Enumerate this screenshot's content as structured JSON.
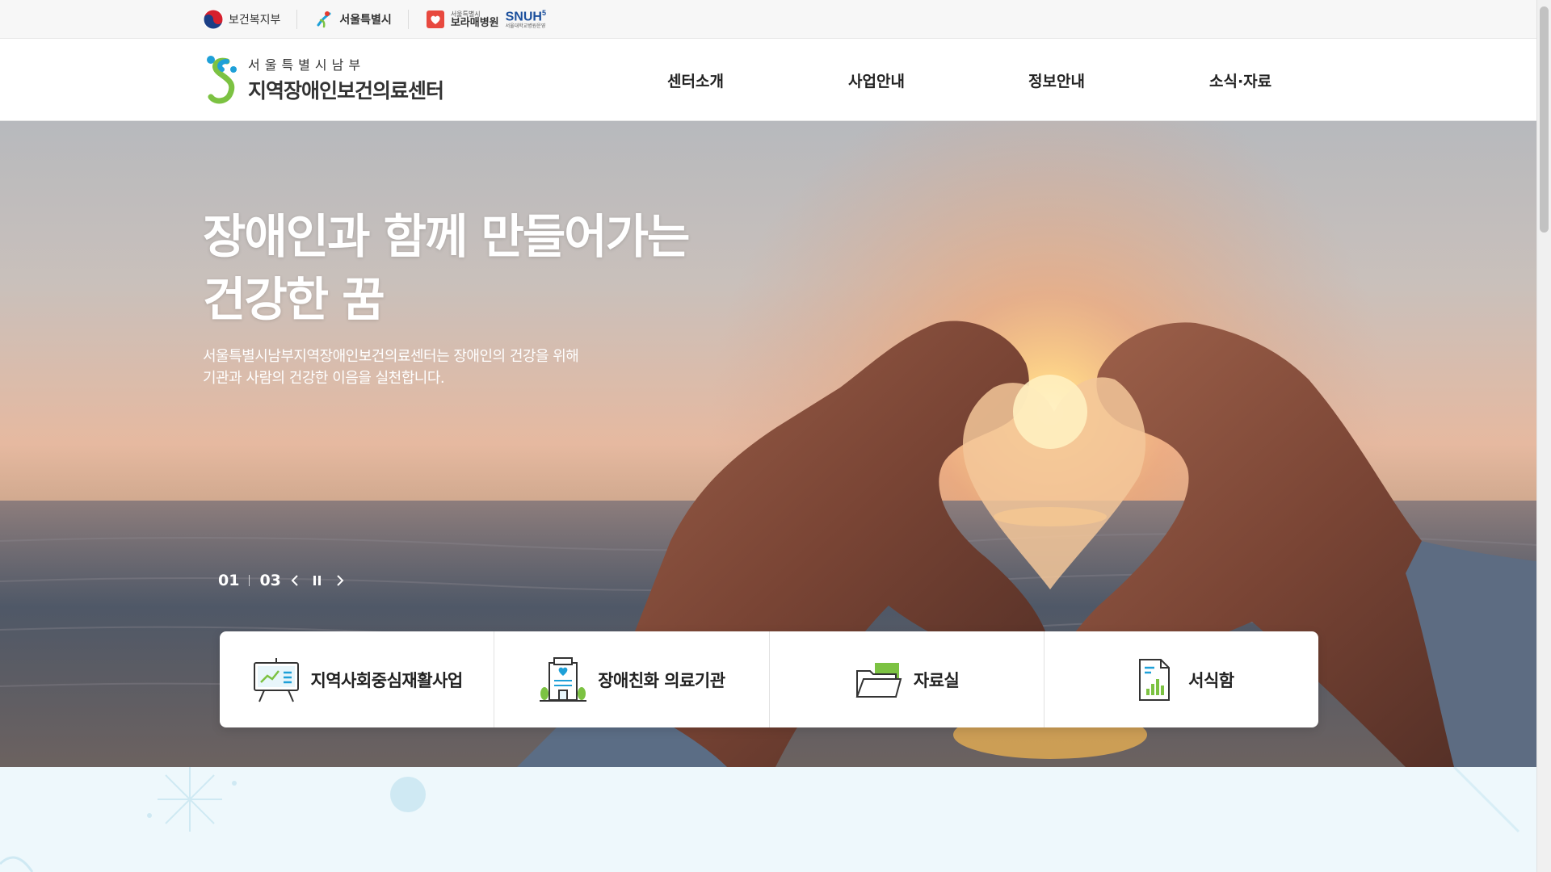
{
  "partners": [
    {
      "name": "보건복지부",
      "icon": "mohw-emblem-icon"
    },
    {
      "name": "서울특별시",
      "icon": "seoul-symbol-icon"
    },
    {
      "name_small": "서울특별시",
      "name": "보라매병원",
      "icon": "boramae-hospital-icon",
      "extra": "SNUH",
      "extra_sup": "5",
      "extra_small": "서울대학교병원운영"
    }
  ],
  "logo": {
    "sub": "서울특별시남부",
    "main": "지역장애인보건의료센터",
    "icon": "center-logo-icon"
  },
  "nav": {
    "items": [
      "센터소개",
      "사업안내",
      "정보안내",
      "소식·자료"
    ]
  },
  "hero": {
    "title_line1": "장애인과 함께 만들어가는",
    "title_line2": "건강한 꿈",
    "desc_line1": "서울특별시남부지역장애인보건의료센터는 장애인의 건강을 위해",
    "desc_line2": "기관과 사람의 건강한 이음을 실천합니다.",
    "current_slide": "01",
    "total_slides": "03"
  },
  "quick_menu": [
    {
      "label": "지역사회중심재활사업",
      "icon": "presentation-board-icon"
    },
    {
      "label": "장애친화 의료기관",
      "icon": "hospital-building-icon"
    },
    {
      "label": "자료실",
      "icon": "folder-icon"
    },
    {
      "label": "서식함",
      "icon": "document-chart-icon"
    }
  ],
  "colors": {
    "brand_green": "#7cc242",
    "brand_blue": "#1ea0d8",
    "brand_navy": "#1b4f9c",
    "lower_bg": "#eef8fc"
  }
}
